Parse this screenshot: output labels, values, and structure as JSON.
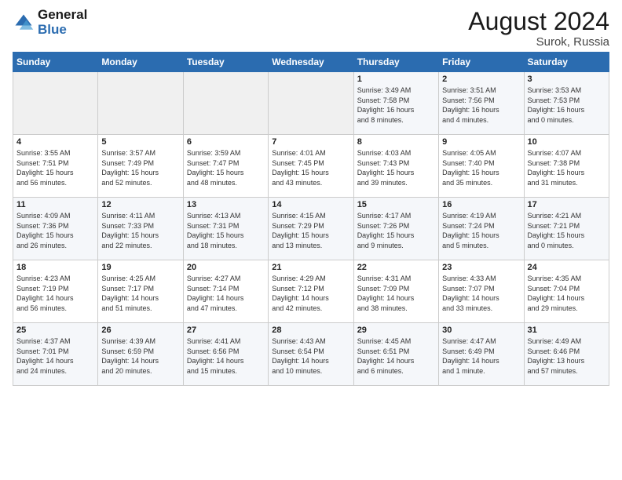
{
  "header": {
    "logo_line1": "General",
    "logo_line2": "Blue",
    "month": "August 2024",
    "location": "Surok, Russia"
  },
  "days_of_week": [
    "Sunday",
    "Monday",
    "Tuesday",
    "Wednesday",
    "Thursday",
    "Friday",
    "Saturday"
  ],
  "weeks": [
    [
      {
        "day": "",
        "info": ""
      },
      {
        "day": "",
        "info": ""
      },
      {
        "day": "",
        "info": ""
      },
      {
        "day": "",
        "info": ""
      },
      {
        "day": "1",
        "info": "Sunrise: 3:49 AM\nSunset: 7:58 PM\nDaylight: 16 hours\nand 8 minutes."
      },
      {
        "day": "2",
        "info": "Sunrise: 3:51 AM\nSunset: 7:56 PM\nDaylight: 16 hours\nand 4 minutes."
      },
      {
        "day": "3",
        "info": "Sunrise: 3:53 AM\nSunset: 7:53 PM\nDaylight: 16 hours\nand 0 minutes."
      }
    ],
    [
      {
        "day": "4",
        "info": "Sunrise: 3:55 AM\nSunset: 7:51 PM\nDaylight: 15 hours\nand 56 minutes."
      },
      {
        "day": "5",
        "info": "Sunrise: 3:57 AM\nSunset: 7:49 PM\nDaylight: 15 hours\nand 52 minutes."
      },
      {
        "day": "6",
        "info": "Sunrise: 3:59 AM\nSunset: 7:47 PM\nDaylight: 15 hours\nand 48 minutes."
      },
      {
        "day": "7",
        "info": "Sunrise: 4:01 AM\nSunset: 7:45 PM\nDaylight: 15 hours\nand 43 minutes."
      },
      {
        "day": "8",
        "info": "Sunrise: 4:03 AM\nSunset: 7:43 PM\nDaylight: 15 hours\nand 39 minutes."
      },
      {
        "day": "9",
        "info": "Sunrise: 4:05 AM\nSunset: 7:40 PM\nDaylight: 15 hours\nand 35 minutes."
      },
      {
        "day": "10",
        "info": "Sunrise: 4:07 AM\nSunset: 7:38 PM\nDaylight: 15 hours\nand 31 minutes."
      }
    ],
    [
      {
        "day": "11",
        "info": "Sunrise: 4:09 AM\nSunset: 7:36 PM\nDaylight: 15 hours\nand 26 minutes."
      },
      {
        "day": "12",
        "info": "Sunrise: 4:11 AM\nSunset: 7:33 PM\nDaylight: 15 hours\nand 22 minutes."
      },
      {
        "day": "13",
        "info": "Sunrise: 4:13 AM\nSunset: 7:31 PM\nDaylight: 15 hours\nand 18 minutes."
      },
      {
        "day": "14",
        "info": "Sunrise: 4:15 AM\nSunset: 7:29 PM\nDaylight: 15 hours\nand 13 minutes."
      },
      {
        "day": "15",
        "info": "Sunrise: 4:17 AM\nSunset: 7:26 PM\nDaylight: 15 hours\nand 9 minutes."
      },
      {
        "day": "16",
        "info": "Sunrise: 4:19 AM\nSunset: 7:24 PM\nDaylight: 15 hours\nand 5 minutes."
      },
      {
        "day": "17",
        "info": "Sunrise: 4:21 AM\nSunset: 7:21 PM\nDaylight: 15 hours\nand 0 minutes."
      }
    ],
    [
      {
        "day": "18",
        "info": "Sunrise: 4:23 AM\nSunset: 7:19 PM\nDaylight: 14 hours\nand 56 minutes."
      },
      {
        "day": "19",
        "info": "Sunrise: 4:25 AM\nSunset: 7:17 PM\nDaylight: 14 hours\nand 51 minutes."
      },
      {
        "day": "20",
        "info": "Sunrise: 4:27 AM\nSunset: 7:14 PM\nDaylight: 14 hours\nand 47 minutes."
      },
      {
        "day": "21",
        "info": "Sunrise: 4:29 AM\nSunset: 7:12 PM\nDaylight: 14 hours\nand 42 minutes."
      },
      {
        "day": "22",
        "info": "Sunrise: 4:31 AM\nSunset: 7:09 PM\nDaylight: 14 hours\nand 38 minutes."
      },
      {
        "day": "23",
        "info": "Sunrise: 4:33 AM\nSunset: 7:07 PM\nDaylight: 14 hours\nand 33 minutes."
      },
      {
        "day": "24",
        "info": "Sunrise: 4:35 AM\nSunset: 7:04 PM\nDaylight: 14 hours\nand 29 minutes."
      }
    ],
    [
      {
        "day": "25",
        "info": "Sunrise: 4:37 AM\nSunset: 7:01 PM\nDaylight: 14 hours\nand 24 minutes."
      },
      {
        "day": "26",
        "info": "Sunrise: 4:39 AM\nSunset: 6:59 PM\nDaylight: 14 hours\nand 20 minutes."
      },
      {
        "day": "27",
        "info": "Sunrise: 4:41 AM\nSunset: 6:56 PM\nDaylight: 14 hours\nand 15 minutes."
      },
      {
        "day": "28",
        "info": "Sunrise: 4:43 AM\nSunset: 6:54 PM\nDaylight: 14 hours\nand 10 minutes."
      },
      {
        "day": "29",
        "info": "Sunrise: 4:45 AM\nSunset: 6:51 PM\nDaylight: 14 hours\nand 6 minutes."
      },
      {
        "day": "30",
        "info": "Sunrise: 4:47 AM\nSunset: 6:49 PM\nDaylight: 14 hours\nand 1 minute."
      },
      {
        "day": "31",
        "info": "Sunrise: 4:49 AM\nSunset: 6:46 PM\nDaylight: 13 hours\nand 57 minutes."
      }
    ]
  ]
}
